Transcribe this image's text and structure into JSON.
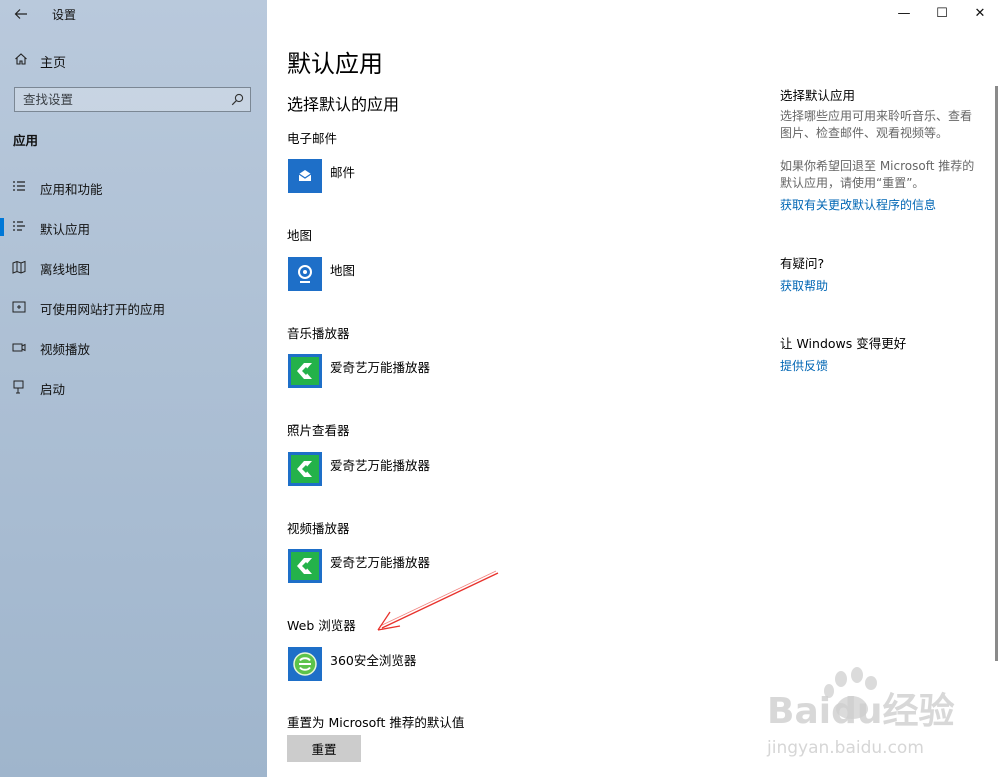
{
  "window": {
    "title": "设置",
    "controls": {
      "minimize": "—",
      "maximize": "☐",
      "close": "✕"
    }
  },
  "sidebar": {
    "home": "主页",
    "search_placeholder": "查找设置",
    "section": "应用",
    "items": [
      {
        "label": "应用和功能",
        "icon": "apps-list-icon"
      },
      {
        "label": "默认应用",
        "icon": "default-apps-icon",
        "active": true
      },
      {
        "label": "离线地图",
        "icon": "map-icon"
      },
      {
        "label": "可使用网站打开的应用",
        "icon": "web-app-icon"
      },
      {
        "label": "视频播放",
        "icon": "video-icon"
      },
      {
        "label": "启动",
        "icon": "startup-icon"
      }
    ]
  },
  "main": {
    "title": "默认应用",
    "subtitle": "选择默认的应用",
    "categories": [
      {
        "label": "电子邮件",
        "app": "邮件",
        "icon": "mail-icon"
      },
      {
        "label": "地图",
        "app": "地图",
        "icon": "maps-icon"
      },
      {
        "label": "音乐播放器",
        "app": "爱奇艺万能播放器",
        "icon": "iqiyi-icon"
      },
      {
        "label": "照片查看器",
        "app": "爱奇艺万能播放器",
        "icon": "iqiyi-icon"
      },
      {
        "label": "视频播放器",
        "app": "爱奇艺万能播放器",
        "icon": "iqiyi-icon"
      },
      {
        "label": "Web 浏览器",
        "app": "360安全浏览器",
        "icon": "360-browser-icon"
      }
    ],
    "reset_label": "重置为 Microsoft 推荐的默认值",
    "reset_button": "重置"
  },
  "right_panel": {
    "section1_title": "选择默认应用",
    "section1_text1a": "选择哪些应用可用来聆听音乐、查看",
    "section1_text1b": "图片、检查邮件、观看视频等。",
    "section1_text2a": "如果你希望回退至 Microsoft 推荐的",
    "section1_text2b": "默认应用，请使用“重置”。",
    "section1_link": "获取有关更改默认程序的信息",
    "section2_title": "有疑问?",
    "section2_link": "获取帮助",
    "section3_title": "让 Windows 变得更好",
    "section3_link": "提供反馈"
  },
  "watermark": {
    "line1": "Baidu经验",
    "line2": "jingyan.baidu.com"
  },
  "colors": {
    "accent": "#0078d7",
    "tile_blue": "#1e6fc8",
    "iqiyi_green": "#24b24a",
    "annotation_red": "#e8322c"
  }
}
